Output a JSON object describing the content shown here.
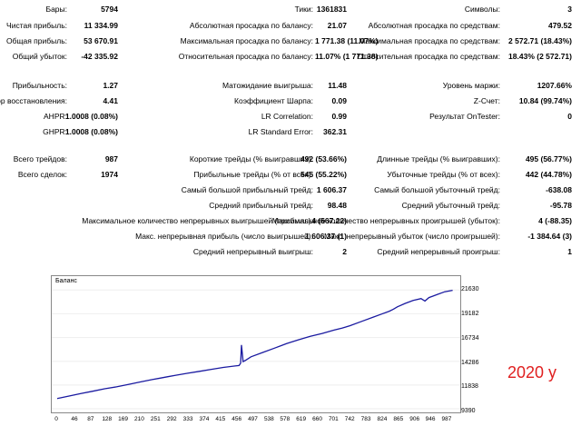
{
  "col1": [
    {
      "label": "Бары:",
      "value": "5794"
    },
    {
      "label": "Чистая прибыль:",
      "value": "11 334.99"
    },
    {
      "label": "Общая прибыль:",
      "value": "53 670.91"
    },
    {
      "label": "Общий убыток:",
      "value": "-42 335.92"
    },
    {
      "label": "Прибыльность:",
      "value": "1.27"
    },
    {
      "label": "Фактор восстановления:",
      "value": "4.41"
    },
    {
      "label": "AHPR:",
      "value": "1.0008 (0.08%)"
    },
    {
      "label": "GHPR:",
      "value": "1.0008 (0.08%)"
    },
    {
      "label": "Всего трейдов:",
      "value": "987"
    },
    {
      "label": "Всего сделок:",
      "value": "1974"
    }
  ],
  "col2": [
    {
      "label": "Тики:",
      "value": "1361831"
    },
    {
      "label": "Абсолютная просадка по балансу:",
      "value": "21.07"
    },
    {
      "label": "Максимальная просадка по балансу:",
      "value": "1 771.38 (11.07%)"
    },
    {
      "label": "Относительная просадка по балансу:",
      "value": "11.07% (1 771.38)"
    },
    {
      "label": "Матожидание выигрыша:",
      "value": "11.48"
    },
    {
      "label": "Коэффициент Шарпа:",
      "value": "0.09"
    },
    {
      "label": "LR Correlation:",
      "value": "0.99"
    },
    {
      "label": "LR Standard Error:",
      "value": "362.31"
    },
    {
      "label": "Короткие трейды (% выигравших):",
      "value": "492 (53.66%)"
    },
    {
      "label": "Прибыльные трейды (% от всех):",
      "value": "545 (55.22%)"
    },
    {
      "label": "Самый большой прибыльный трейд:",
      "value": "1 606.37"
    },
    {
      "label": "Средний прибыльный трейд:",
      "value": "98.48"
    },
    {
      "label": "Максимальное количество непрерывных выигрышей (прибыль):",
      "value": "4 (567.22)"
    },
    {
      "label": "Макс. непрерывная прибыль (число выигрышей):",
      "value": "1 606.37 (1)"
    },
    {
      "label": "Средний непрерывный выигрыш:",
      "value": "2"
    }
  ],
  "col3": [
    {
      "label": "Символы:",
      "value": "3"
    },
    {
      "label": "Абсолютная просадка по средствам:",
      "value": "479.52"
    },
    {
      "label": "Максимальная просадка по средствам:",
      "value": "2 572.71 (18.43%)"
    },
    {
      "label": "Относительная просадка по средствам:",
      "value": "18.43% (2 572.71)"
    },
    {
      "label": "Уровень маржи:",
      "value": "1207.66%"
    },
    {
      "label": "Z-Счет:",
      "value": "10.84 (99.74%)"
    },
    {
      "label": "Результат OnTester:",
      "value": "0"
    },
    {
      "label": "Длинные трейды (% выигравших):",
      "value": "495 (56.77%)"
    },
    {
      "label": "Убыточные трейды (% от всех):",
      "value": "442 (44.78%)"
    },
    {
      "label": "Самый большой убыточный трейд:",
      "value": "-638.08"
    },
    {
      "label": "Средний убыточный трейд:",
      "value": "-95.78"
    },
    {
      "label": "Максимальное количество непрерывных проигрышей (убыток):",
      "value": "4 (-88.35)"
    },
    {
      "label": "Макс. непрерывный убыток (число проигрышей):",
      "value": "-1 384.64 (3)"
    },
    {
      "label": "Средний непрерывный проигрыш:",
      "value": "1"
    }
  ],
  "annotation": "2020 y",
  "chart_data": {
    "type": "line",
    "title": "Баланс",
    "ylim": [
      9390,
      22500
    ],
    "xlim": [
      0,
      1010
    ],
    "y_ticks": [
      "21630",
      "19182",
      "16734",
      "14286",
      "11838",
      "9390"
    ],
    "x_ticks": [
      "0",
      "46",
      "87",
      "128",
      "169",
      "210",
      "251",
      "292",
      "333",
      "374",
      "415",
      "456",
      "497",
      "538",
      "578",
      "619",
      "660",
      "701",
      "742",
      "783",
      "824",
      "865",
      "906",
      "946",
      "987"
    ],
    "color": "#1a1aa0",
    "series": [
      {
        "x": [
          0,
          30,
          60,
          90,
          120,
          150,
          180,
          210,
          240,
          260,
          280,
          300,
          330,
          360,
          390,
          420,
          450,
          460,
          464,
          466,
          470,
          475,
          490,
          520,
          550,
          580,
          610,
          640,
          670,
          700,
          720,
          740,
          770,
          800,
          820,
          840,
          850,
          860,
          880,
          900,
          920,
          930,
          940,
          950,
          960,
          980,
          1000
        ],
        "y": [
          10450,
          10700,
          10950,
          11200,
          11450,
          11650,
          11900,
          12150,
          12400,
          12550,
          12700,
          12850,
          13050,
          13250,
          13450,
          13650,
          13800,
          13850,
          14100,
          15960,
          14250,
          14350,
          14750,
          15200,
          15650,
          16100,
          16500,
          16850,
          17150,
          17500,
          17700,
          17950,
          18400,
          18850,
          19150,
          19450,
          19650,
          19900,
          20250,
          20550,
          20750,
          20500,
          20850,
          21000,
          21150,
          21450,
          21600
        ]
      }
    ]
  }
}
